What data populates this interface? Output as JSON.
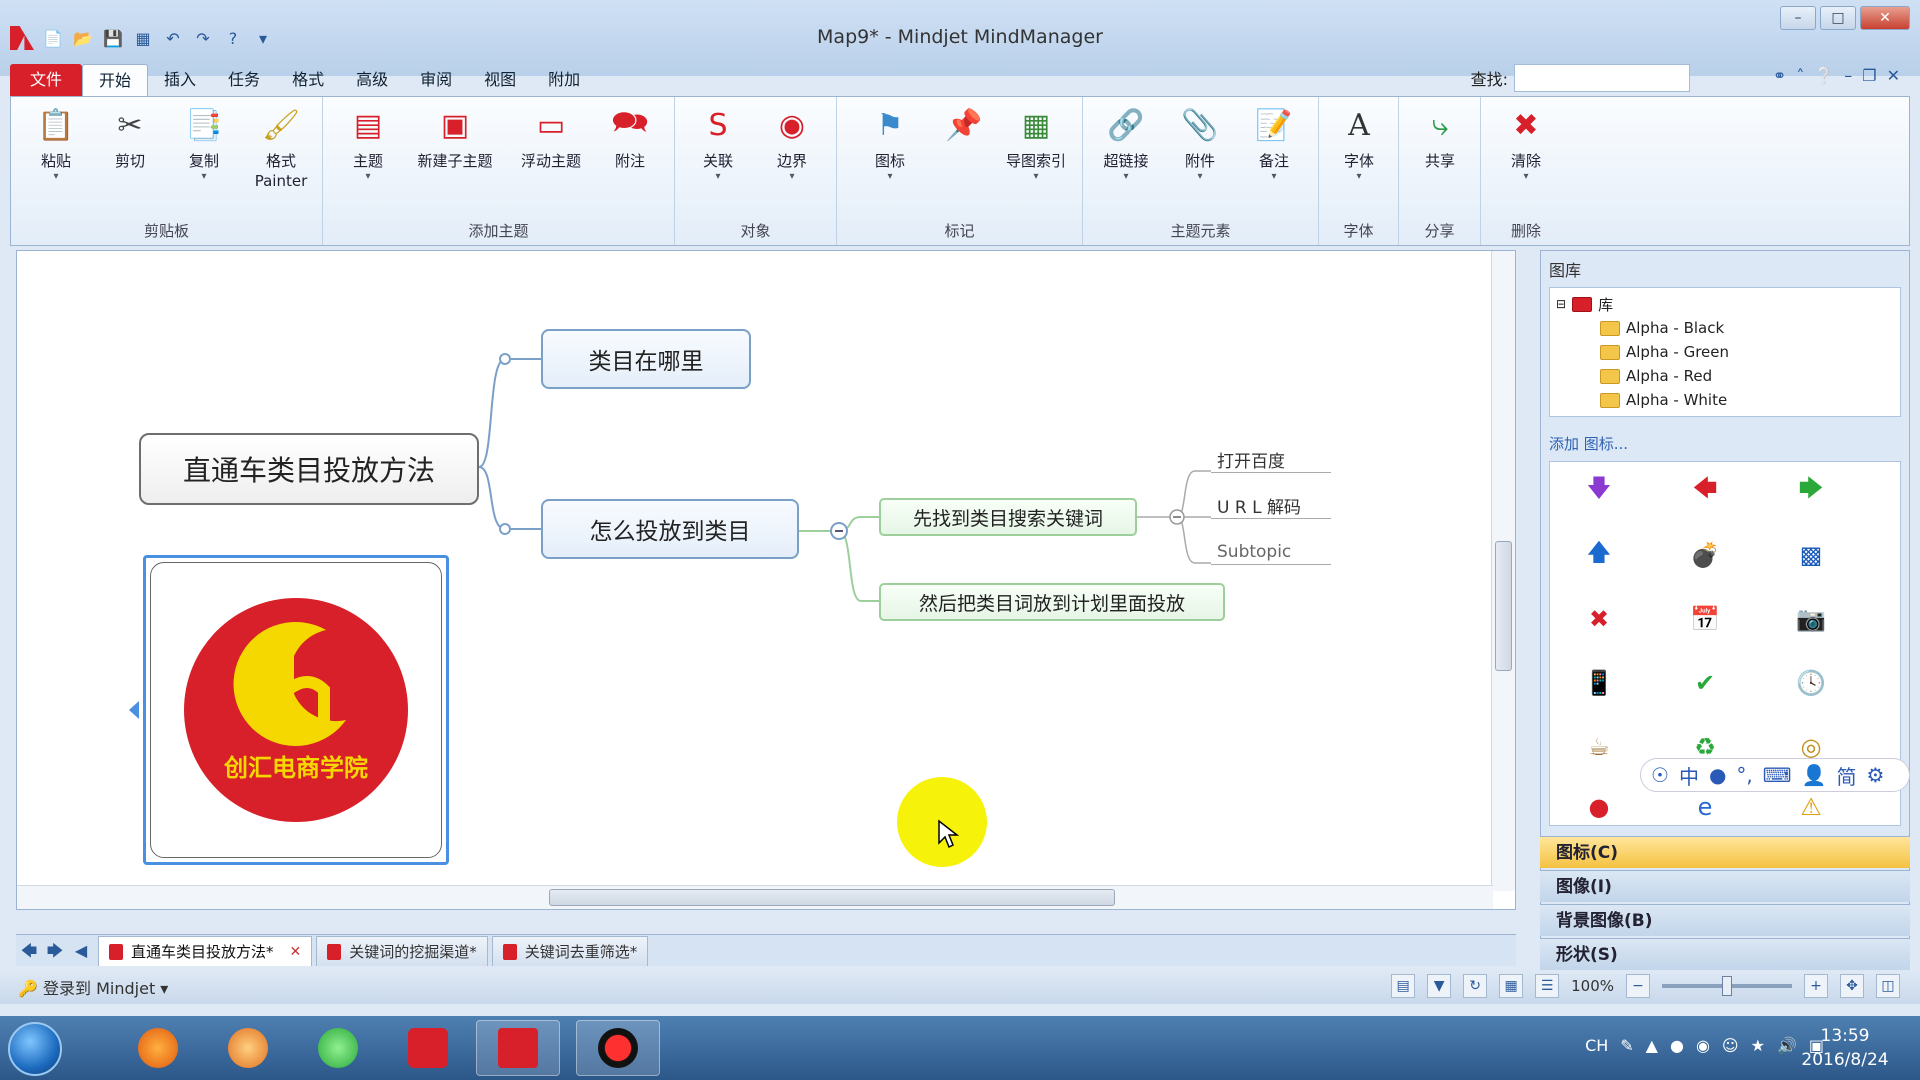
{
  "window": {
    "title": "Map9* - Mindjet MindManager"
  },
  "menu_tabs": [
    "文件",
    "开始",
    "插入",
    "任务",
    "格式",
    "高级",
    "审阅",
    "视图",
    "附加"
  ],
  "search": {
    "label": "查找:",
    "value": ""
  },
  "ribbon": {
    "clipboard": {
      "label": "剪贴板",
      "paste": "粘贴",
      "cut": "剪切",
      "copy": "复制",
      "format_painter": "格式\nPainter"
    },
    "add_topic": {
      "label": "添加主题",
      "topic": "主题",
      "new_subtopic": "新建子主题",
      "floating_topic": "浮动主题",
      "callout": "附注"
    },
    "objects": {
      "label": "对象",
      "relationship": "关联",
      "boundary": "边界"
    },
    "markers": {
      "label": "标记",
      "icons": "图标",
      "map_index": "导图索引"
    },
    "topic_elements": {
      "label": "主题元素",
      "hyperlink": "超链接",
      "attachment": "附件",
      "notes": "备注"
    },
    "font": {
      "label": "字体",
      "font": "字体"
    },
    "share": {
      "label": "分享",
      "share": "共享"
    },
    "delete": {
      "label": "删除",
      "clear": "清除"
    }
  },
  "map": {
    "central": "直通车类目投放方法",
    "main1": "类目在哪里",
    "main2": "怎么投放到类目",
    "sub1": "先找到类目搜索关键词",
    "sub2": "然后把类目词放到计划里面投放",
    "leaf1": "打开百度",
    "leaf2": "U R L 解码",
    "leaf3": "Subtopic",
    "logo_text": "创汇电商学院"
  },
  "doc_tabs": [
    "直通车类目投放方法*",
    "关键词的挖掘渠道*",
    "关键词去重筛选*"
  ],
  "status": {
    "login": "登录到 Mindjet",
    "zoom": "100%"
  },
  "library": {
    "title": "图库",
    "root": "库",
    "folders": [
      "Alpha - Black",
      "Alpha - Green",
      "Alpha - Red",
      "Alpha - White"
    ],
    "add_icon": "添加 图标...",
    "panes": [
      "图标(C)",
      "图像(I)",
      "背景图像(B)",
      "形状(S)"
    ]
  },
  "ime": {
    "lang": "中",
    "mode": "简"
  },
  "taskbar": {
    "lang": "CH",
    "time": "13:59",
    "date": "2016/8/24"
  },
  "colors": {
    "accent_red": "#d8202a",
    "logo_yellow": "#f5d800",
    "highlight": "#f6f20a"
  }
}
